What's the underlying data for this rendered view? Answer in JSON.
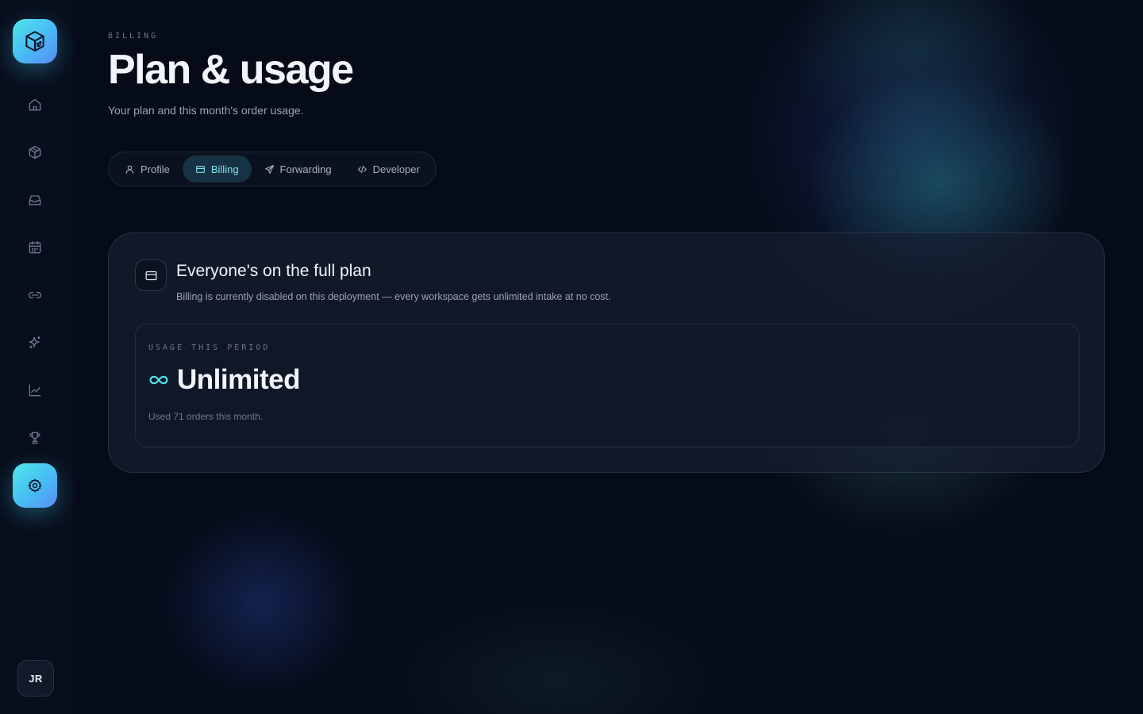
{
  "sidebar": {
    "logo_icon": "cube-logo-icon",
    "items": [
      {
        "icon": "home-icon",
        "active": false
      },
      {
        "icon": "package-icon",
        "active": false
      },
      {
        "icon": "inbox-icon",
        "active": false
      },
      {
        "icon": "calendar-icon",
        "active": false
      },
      {
        "icon": "link-icon",
        "active": false
      },
      {
        "icon": "sparkles-icon",
        "active": false
      },
      {
        "icon": "chart-line-icon",
        "active": false
      },
      {
        "icon": "trophy-icon",
        "active": false
      },
      {
        "icon": "gear-icon",
        "active": true
      }
    ],
    "avatar_initials": "JR"
  },
  "header": {
    "eyebrow": "BILLING",
    "title": "Plan & usage",
    "subtitle": "Your plan and this month's order usage."
  },
  "tabs": [
    {
      "label": "Profile",
      "icon": "user-icon",
      "active": false
    },
    {
      "label": "Billing",
      "icon": "credit-card-icon",
      "active": true
    },
    {
      "label": "Forwarding",
      "icon": "send-icon",
      "active": false
    },
    {
      "label": "Developer",
      "icon": "code-icon",
      "active": false
    }
  ],
  "plan_card": {
    "icon": "credit-card-icon",
    "title": "Everyone's on the full plan",
    "description": "Billing is currently disabled on this deployment — every workspace gets unlimited intake at no cost.",
    "usage": {
      "label": "USAGE THIS PERIOD",
      "icon": "infinity-icon",
      "value": "Unlimited",
      "note": "Used 71 orders this month."
    }
  },
  "colors": {
    "background": "#060b18",
    "accent": "#4ee7e9",
    "accent_text": "#7fe3f0",
    "muted_text": "#9aa3b3"
  }
}
